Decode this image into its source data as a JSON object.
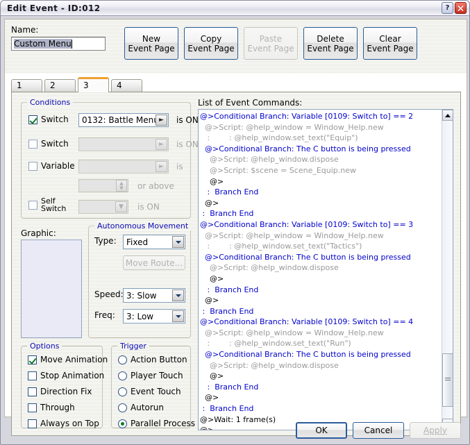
{
  "window": {
    "title": "Edit Event - ID:012",
    "help_icon": "question-mark-icon",
    "close_icon": "close-icon"
  },
  "name_field": {
    "label": "Name:",
    "value": "Custom Menu",
    "selected": true
  },
  "page_buttons": [
    {
      "line1": "New",
      "line2": "Event Page",
      "enabled": true
    },
    {
      "line1": "Copy",
      "line2": "Event Page",
      "enabled": true
    },
    {
      "line1": "Paste",
      "line2": "Event Page",
      "enabled": false
    },
    {
      "line1": "Delete",
      "line2": "Event Page",
      "enabled": true
    },
    {
      "line1": "Clear",
      "line2": "Event Page",
      "enabled": true
    }
  ],
  "tabs": [
    {
      "label": "1",
      "active": false
    },
    {
      "label": "2",
      "active": false
    },
    {
      "label": "3",
      "active": true
    },
    {
      "label": "4",
      "active": false
    }
  ],
  "conditions": {
    "legend": "Conditions",
    "rows": [
      {
        "label": "Switch",
        "checked": true,
        "value": "0132: Battle Menu",
        "suffix": "is ON",
        "enabled": true
      },
      {
        "label": "Switch",
        "checked": false,
        "value": "",
        "suffix": "is ON",
        "enabled": false
      },
      {
        "label": "Variable",
        "checked": false,
        "value": "",
        "suffix": "is",
        "enabled": false
      },
      {
        "label": "",
        "checked": null,
        "value": "",
        "suffix": "or above",
        "enabled": false
      },
      {
        "label": "Self Switch",
        "checked": false,
        "value": "",
        "suffix": "is ON",
        "enabled": false
      }
    ]
  },
  "graphic": {
    "label": "Graphic:"
  },
  "autonomous_movement": {
    "legend": "Autonomous Movement",
    "type_label": "Type:",
    "type_value": "Fixed",
    "move_route_label": "Move Route...",
    "move_route_enabled": false,
    "speed_label": "Speed:",
    "speed_value": "3: Slow",
    "freq_label": "Freq:",
    "freq_value": "3: Low"
  },
  "options": {
    "legend": "Options",
    "items": [
      {
        "label": "Move Animation",
        "checked": true
      },
      {
        "label": "Stop Animation",
        "checked": false
      },
      {
        "label": "Direction Fix",
        "checked": false
      },
      {
        "label": "Through",
        "checked": false
      },
      {
        "label": "Always on Top",
        "checked": false
      }
    ]
  },
  "trigger": {
    "legend": "Trigger",
    "items": [
      {
        "label": "Action Button",
        "selected": false
      },
      {
        "label": "Player Touch",
        "selected": false
      },
      {
        "label": "Event Touch",
        "selected": false
      },
      {
        "label": "Autorun",
        "selected": false
      },
      {
        "label": "Parallel Process",
        "selected": true
      }
    ]
  },
  "event_commands": {
    "label": "List of Event Commands:",
    "lines": [
      {
        "text": "@>Conditional Branch: Variable [0109: Switch to] == 2",
        "kind": "branch"
      },
      {
        "text": "  @>Script: @help_window = Window_Help.new",
        "kind": "script"
      },
      {
        "text": "   :        : @help_window.set_text(\"Equip\")",
        "kind": "script"
      },
      {
        "text": "  @>Conditional Branch: The C button is being pressed",
        "kind": "branch"
      },
      {
        "text": "    @>Script: @help_window.dispose",
        "kind": "script"
      },
      {
        "text": "    @>Script: $scene = Scene_Equip.new",
        "kind": "script"
      },
      {
        "text": "    @>",
        "kind": "plain"
      },
      {
        "text": "   :  Branch End",
        "kind": "branch"
      },
      {
        "text": "  @>",
        "kind": "plain"
      },
      {
        "text": " :  Branch End",
        "kind": "branch"
      },
      {
        "text": "@>Conditional Branch: Variable [0109: Switch to] == 3",
        "kind": "branch"
      },
      {
        "text": "  @>Script: @help_window = Window_Help.new",
        "kind": "script"
      },
      {
        "text": "   :        : @help_window.set_text(\"Tactics\")",
        "kind": "script"
      },
      {
        "text": "  @>Conditional Branch: The C button is being pressed",
        "kind": "branch"
      },
      {
        "text": "    @>Script: @help_window.dispose",
        "kind": "script"
      },
      {
        "text": "    @>",
        "kind": "plain"
      },
      {
        "text": "   :  Branch End",
        "kind": "branch"
      },
      {
        "text": "  @>",
        "kind": "plain"
      },
      {
        "text": " :  Branch End",
        "kind": "branch"
      },
      {
        "text": "@>Conditional Branch: Variable [0109: Switch to] == 4",
        "kind": "branch"
      },
      {
        "text": "  @>Script: @help_window = Window_Help.new",
        "kind": "script"
      },
      {
        "text": "   :        : @help_window.set_text(\"Run\")",
        "kind": "script"
      },
      {
        "text": "  @>Conditional Branch: The C button is being pressed",
        "kind": "branch"
      },
      {
        "text": "    @>Script: @help_window.dispose",
        "kind": "script"
      },
      {
        "text": "    @>",
        "kind": "plain"
      },
      {
        "text": "   :  Branch End",
        "kind": "branch"
      },
      {
        "text": "  @>",
        "kind": "plain"
      },
      {
        "text": " :  Branch End",
        "kind": "branch"
      },
      {
        "text": "@>Wait: 1 frame(s)",
        "kind": "plain"
      },
      {
        "text": "@>",
        "kind": "plain"
      }
    ],
    "scrollbar": {
      "thumb_top_pct": 78,
      "thumb_height_pct": 18
    }
  },
  "dialog_buttons": [
    {
      "label": "OK",
      "enabled": true,
      "default": true
    },
    {
      "label": "Cancel",
      "enabled": true,
      "default": false
    },
    {
      "label": "Apply",
      "enabled": false,
      "default": false
    }
  ],
  "colors": {
    "legend_blue": "#0a0ab4",
    "branch_blue": "#0000cc",
    "script_gray": "#9a9a9a",
    "tab_accent": "#f0a030",
    "button_border": "#2b5c9b"
  }
}
